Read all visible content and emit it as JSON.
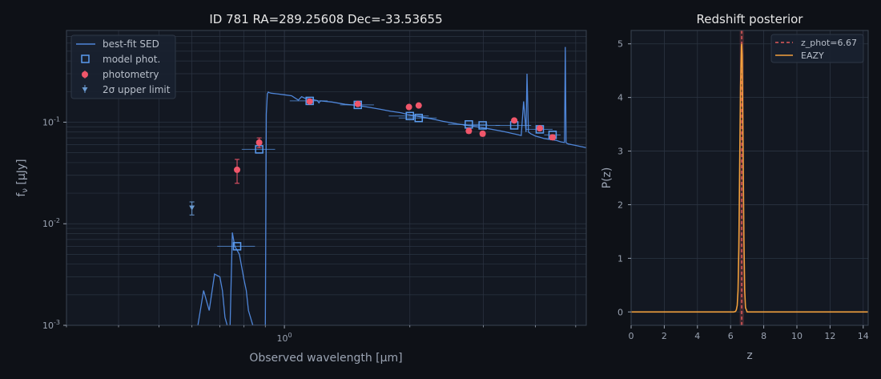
{
  "colors": {
    "background": "#0e1117",
    "axes_bg": "#131822",
    "grid": "#2b3442",
    "spine": "#3a4352",
    "sed": "#4f86d9",
    "model_phot": "#5b9cf0",
    "photometry": "#f0566a",
    "upper_limit": "#6a9ad0",
    "eazy": "#f2a03d",
    "zphot_line": "#e05a5a"
  },
  "chart_data": [
    {
      "type": "line",
      "title": "ID 781  RA=289.25608  Dec=-33.53655",
      "xlabel": "Observed wavelength [μm]",
      "ylabel": "f_ν [μJy]",
      "xscale": "log",
      "yscale": "log",
      "xlim": [
        0.3,
        5.3
      ],
      "ylim": [
        0.001,
        0.8
      ],
      "x_ticks": [
        {
          "value": 1.0,
          "label": "10^0"
        }
      ],
      "y_ticks": [
        {
          "value": 0.001,
          "label": "10^-3"
        },
        {
          "value": 0.01,
          "label": "10^-2"
        },
        {
          "value": 0.1,
          "label": "10^-1"
        }
      ],
      "grid": true,
      "legend": {
        "placement": "top-left",
        "entries": [
          "best-fit SED",
          "model phot.",
          "photometry",
          "2σ upper limit"
        ]
      },
      "series": [
        {
          "name": "best-fit SED",
          "style": "line",
          "x": [
            0.62,
            0.64,
            0.66,
            0.68,
            0.7,
            0.71,
            0.72,
            0.74,
            0.75,
            0.755,
            0.76,
            0.77,
            0.78,
            0.8,
            0.81,
            0.82,
            0.84,
            0.86,
            0.87,
            0.875,
            0.88,
            0.9,
            0.905,
            0.91,
            0.915,
            0.92,
            0.93,
            0.96,
            1.0,
            1.04,
            1.08,
            1.1,
            1.12,
            1.16,
            1.2,
            1.21,
            1.22,
            1.3,
            1.4,
            1.5,
            1.6,
            1.7,
            1.8,
            1.9,
            2.0,
            2.1,
            2.2,
            2.3,
            2.4,
            2.5,
            2.6,
            2.7,
            2.8,
            2.9,
            3.0,
            3.1,
            3.2,
            3.3,
            3.4,
            3.5,
            3.6,
            3.7,
            3.75,
            3.8,
            3.82,
            3.85,
            3.9,
            3.95,
            4.0,
            4.1,
            4.2,
            4.3,
            4.4,
            4.5,
            4.6,
            4.7,
            4.72,
            4.74,
            4.76,
            4.8,
            4.9,
            5.0,
            5.1,
            5.2,
            5.3
          ],
          "y": [
            0.001,
            0.0022,
            0.0014,
            0.0032,
            0.003,
            0.0022,
            0.0012,
            0.0008,
            0.0082,
            0.007,
            0.006,
            0.0055,
            0.005,
            0.0028,
            0.0022,
            0.0014,
            0.001,
            0.001,
            0.001,
            0.001,
            0.001,
            0.001,
            0.12,
            0.19,
            0.198,
            0.195,
            0.193,
            0.19,
            0.186,
            0.182,
            0.165,
            0.178,
            0.172,
            0.168,
            0.163,
            0.155,
            0.162,
            0.158,
            0.15,
            0.146,
            0.14,
            0.134,
            0.128,
            0.124,
            0.118,
            0.114,
            0.11,
            0.106,
            0.102,
            0.099,
            0.096,
            0.094,
            0.092,
            0.09,
            0.088,
            0.086,
            0.084,
            0.082,
            0.08,
            0.078,
            0.076,
            0.074,
            0.16,
            0.08,
            0.3,
            0.08,
            0.077,
            0.075,
            0.073,
            0.071,
            0.069,
            0.068,
            0.067,
            0.066,
            0.064,
            0.063,
            0.55,
            0.063,
            0.062,
            0.061,
            0.06,
            0.059,
            0.058,
            0.057,
            0.056
          ]
        },
        {
          "name": "model phot.",
          "style": "square",
          "x": [
            0.77,
            0.87,
            1.15,
            1.5,
            2.0,
            2.1,
            2.77,
            2.99,
            3.56,
            4.1,
            4.4
          ],
          "y": [
            0.006,
            0.054,
            0.162,
            0.148,
            0.115,
            0.11,
            0.095,
            0.093,
            0.093,
            0.085,
            0.075
          ],
          "xerr": [
            0.08,
            0.08,
            0.12,
            0.14,
            0.22,
            0.22,
            0.3,
            0.3,
            0.35,
            0.3,
            0.2
          ]
        },
        {
          "name": "photometry",
          "style": "circle",
          "x": [
            0.77,
            0.87,
            1.15,
            1.5,
            1.99,
            2.1,
            2.77,
            2.99,
            3.56,
            4.1,
            4.4
          ],
          "y": [
            0.034,
            0.063,
            0.16,
            0.151,
            0.141,
            0.146,
            0.082,
            0.077,
            0.104,
            0.087,
            0.071
          ],
          "yerr": [
            0.009,
            0.007,
            0.004,
            0.004,
            0.005,
            0.005,
            0.004,
            0.004,
            0.004,
            0.004,
            0.004
          ]
        },
        {
          "name": "2σ upper limit",
          "style": "triangle-down",
          "x": [
            0.6
          ],
          "y": [
            0.0143
          ],
          "yerr": [
            0.0021
          ]
        }
      ]
    },
    {
      "type": "line",
      "title": "Redshift posterior",
      "xlabel": "z",
      "ylabel": "P(z)",
      "xlim": [
        0.0,
        14.3
      ],
      "ylim": [
        -0.25,
        5.25
      ],
      "x_ticks": [
        0,
        2,
        4,
        6,
        8,
        10,
        12,
        14
      ],
      "y_ticks": [
        0,
        1,
        2,
        3,
        4,
        5
      ],
      "grid": true,
      "legend": {
        "placement": "top-right",
        "entries": [
          "z_phot=6.67",
          "EAZY"
        ]
      },
      "z_phot": 6.67,
      "z_band": [
        6.55,
        6.8
      ],
      "series": [
        {
          "name": "EAZY",
          "style": "line",
          "x": [
            0.0,
            6.2,
            6.3,
            6.35,
            6.4,
            6.45,
            6.5,
            6.55,
            6.6,
            6.65,
            6.67,
            6.7,
            6.75,
            6.8,
            6.85,
            6.9,
            7.0,
            14.3
          ],
          "y": [
            0.0,
            0.0,
            0.01,
            0.04,
            0.12,
            0.4,
            1.2,
            2.8,
            4.2,
            4.95,
            5.0,
            4.8,
            3.2,
            1.4,
            0.4,
            0.08,
            0.0,
            0.0
          ]
        }
      ]
    }
  ]
}
